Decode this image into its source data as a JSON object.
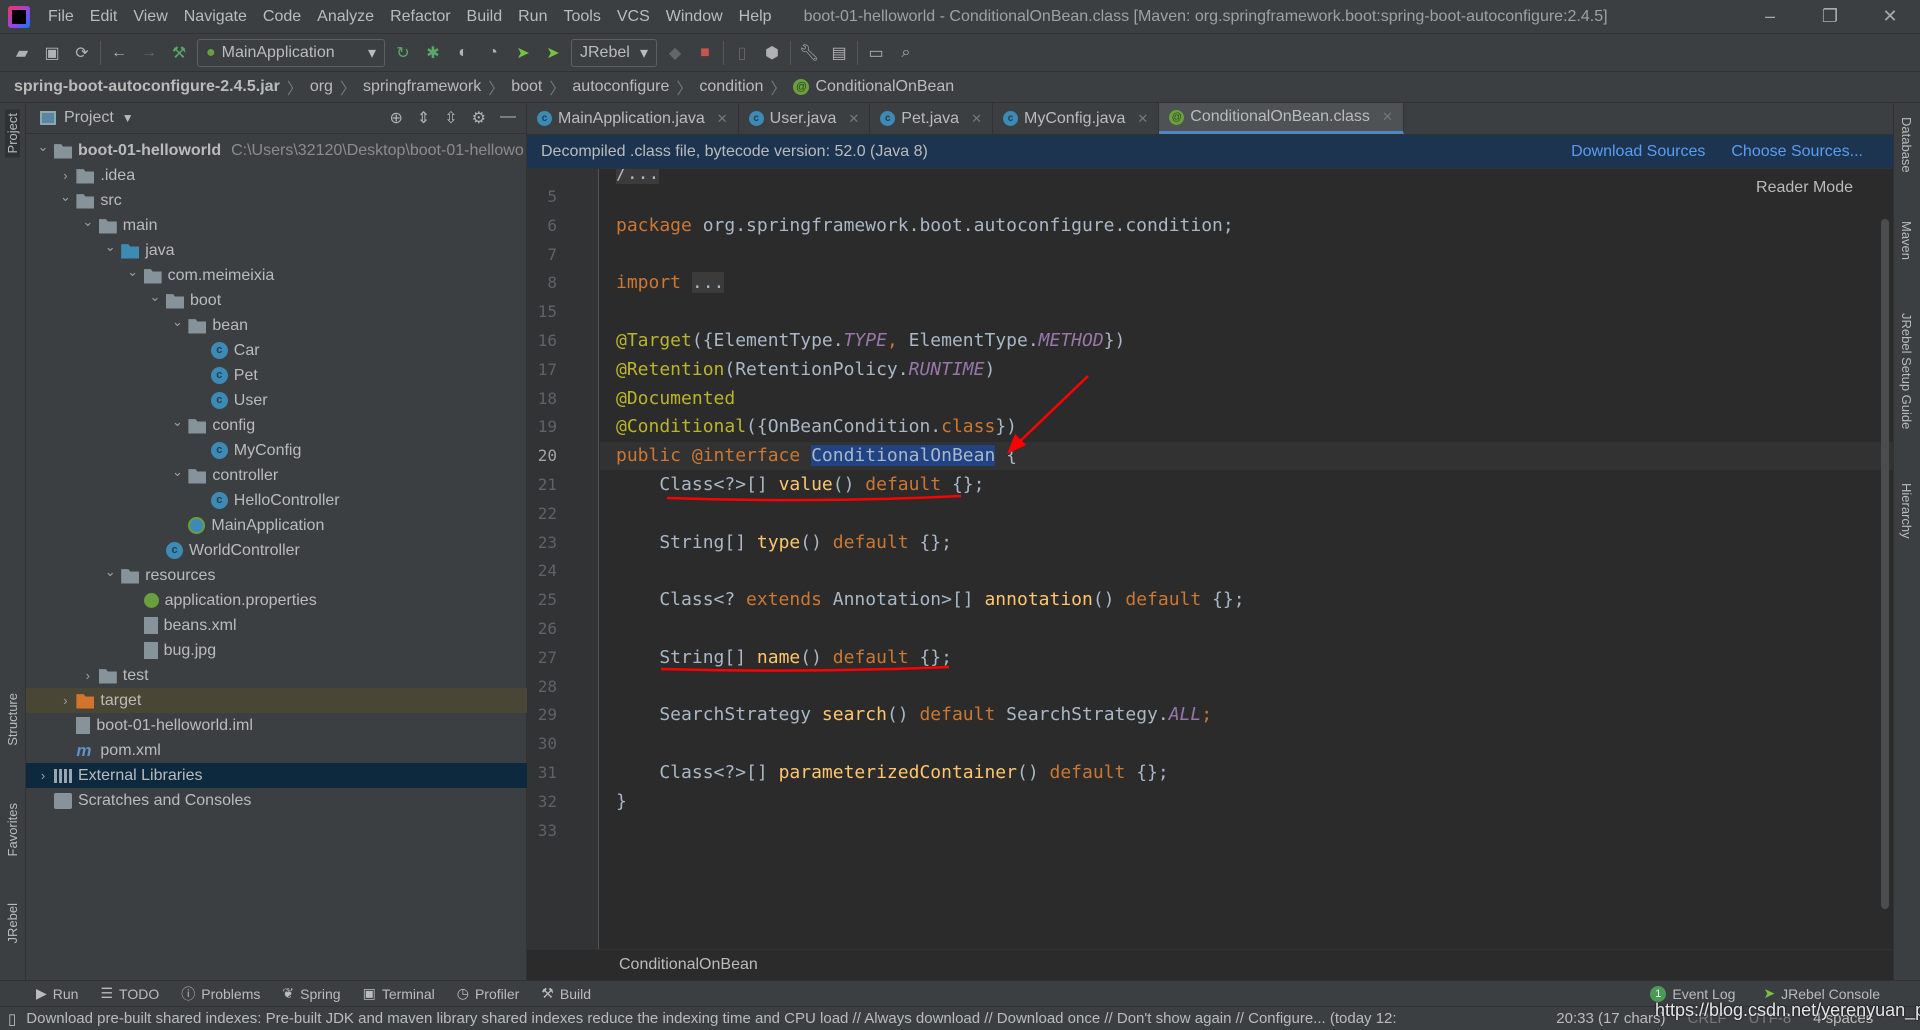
{
  "window": {
    "title": "boot-01-helloworld - ConditionalOnBean.class [Maven: org.springframework.boot:spring-boot-autoconfigure:2.4.5]"
  },
  "menu": [
    "File",
    "Edit",
    "View",
    "Navigate",
    "Code",
    "Analyze",
    "Refactor",
    "Build",
    "Run",
    "Tools",
    "VCS",
    "Window",
    "Help"
  ],
  "toolbar": {
    "run_config": "MainApplication",
    "jrebel": "JRebel"
  },
  "breadcrumb": [
    "spring-boot-autoconfigure-2.4.5.jar",
    "org",
    "springframework",
    "boot",
    "autoconfigure",
    "condition",
    "ConditionalOnBean"
  ],
  "left_stripe": {
    "project": "Project",
    "structure": "Structure",
    "favorites": "Favorites",
    "jrebel": "JRebel"
  },
  "right_stripe": {
    "database": "Database",
    "maven": "Maven",
    "jrebel_guide": "JRebel Setup Guide",
    "hierarchy": "Hierarchy"
  },
  "project": {
    "title": "Project",
    "tree": [
      {
        "d": 0,
        "a": "open",
        "i": "folder",
        "label": "boot-01-helloworld",
        "path": "C:\\Users\\32120\\Desktop\\boot-01-hellowo",
        "bold": true
      },
      {
        "d": 1,
        "a": "closed",
        "i": "folder",
        "label": ".idea"
      },
      {
        "d": 1,
        "a": "open",
        "i": "folder",
        "label": "src"
      },
      {
        "d": 2,
        "a": "open",
        "i": "folder",
        "label": "main"
      },
      {
        "d": 3,
        "a": "open",
        "i": "folder blue",
        "label": "java"
      },
      {
        "d": 4,
        "a": "open",
        "i": "pkg",
        "label": "com.meimeixia"
      },
      {
        "d": 5,
        "a": "open",
        "i": "pkg",
        "label": "boot"
      },
      {
        "d": 6,
        "a": "open",
        "i": "pkg",
        "label": "bean"
      },
      {
        "d": 7,
        "a": "",
        "i": "cls",
        "label": "Car"
      },
      {
        "d": 7,
        "a": "",
        "i": "cls",
        "label": "Pet"
      },
      {
        "d": 7,
        "a": "",
        "i": "cls",
        "label": "User"
      },
      {
        "d": 6,
        "a": "open",
        "i": "pkg",
        "label": "config"
      },
      {
        "d": 7,
        "a": "",
        "i": "cls",
        "label": "MyConfig"
      },
      {
        "d": 6,
        "a": "open",
        "i": "pkg",
        "label": "controller"
      },
      {
        "d": 7,
        "a": "",
        "i": "cls",
        "label": "HelloController"
      },
      {
        "d": 6,
        "a": "",
        "i": "spring",
        "label": "MainApplication"
      },
      {
        "d": 5,
        "a": "",
        "i": "cls",
        "label": "WorldController"
      },
      {
        "d": 3,
        "a": "open",
        "i": "folder",
        "label": "resources"
      },
      {
        "d": 4,
        "a": "",
        "i": "props",
        "label": "application.properties"
      },
      {
        "d": 4,
        "a": "",
        "i": "file",
        "label": "beans.xml"
      },
      {
        "d": 4,
        "a": "",
        "i": "file",
        "label": "bug.jpg"
      },
      {
        "d": 2,
        "a": "closed",
        "i": "folder",
        "label": "test"
      },
      {
        "d": 1,
        "a": "closed",
        "i": "folder orange",
        "label": "target",
        "state": "hl"
      },
      {
        "d": 1,
        "a": "",
        "i": "file",
        "label": "boot-01-helloworld.iml"
      },
      {
        "d": 1,
        "a": "",
        "i": "mvn",
        "label": "pom.xml"
      },
      {
        "d": 0,
        "a": "closed",
        "i": "lib",
        "label": "External Libraries",
        "state": "sel"
      },
      {
        "d": 0,
        "a": "",
        "i": "scr",
        "label": "Scratches and Consoles"
      }
    ]
  },
  "tabs": [
    {
      "label": "MainApplication.java",
      "icon": "spring-class-icon"
    },
    {
      "label": "User.java",
      "icon": "class-icon"
    },
    {
      "label": "Pet.java",
      "icon": "class-icon"
    },
    {
      "label": "MyConfig.java",
      "icon": "class-icon"
    },
    {
      "label": "ConditionalOnBean.class",
      "icon": "annotation-icon",
      "active": true
    }
  ],
  "banner": {
    "text": "Decompiled .class file, bytecode version: 52.0 (Java 8)",
    "download": "Download Sources",
    "choose": "Choose Sources..."
  },
  "editor": {
    "reader_mode": "Reader Mode",
    "current_line": "20",
    "lines": [
      {
        "n": "5",
        "t": []
      },
      {
        "n": "6",
        "t": [
          [
            "kw",
            "package "
          ],
          [
            "",
            "org.springframework.boot.autoconfigure.condition;"
          ]
        ]
      },
      {
        "n": "7",
        "t": []
      },
      {
        "n": "8",
        "t": [
          [
            "kw",
            "import "
          ],
          [
            "fold",
            "..."
          ]
        ]
      },
      {
        "n": "15",
        "t": []
      },
      {
        "n": "16",
        "t": [
          [
            "an",
            "@Target"
          ],
          [
            "",
            "({ElementType."
          ],
          [
            "st",
            "TYPE"
          ],
          [
            "kw",
            ", "
          ],
          [
            "",
            "ElementType."
          ],
          [
            "st",
            "METHOD"
          ],
          [
            "",
            "})"
          ]
        ]
      },
      {
        "n": "17",
        "t": [
          [
            "an",
            "@Retention"
          ],
          [
            "",
            "(RetentionPolicy."
          ],
          [
            "st",
            "RUNTIME"
          ],
          [
            "",
            ")"
          ]
        ]
      },
      {
        "n": "18",
        "t": [
          [
            "an",
            "@Documented"
          ]
        ]
      },
      {
        "n": "19",
        "t": [
          [
            "an",
            "@Conditional"
          ],
          [
            "",
            "({OnBeanCondition."
          ],
          [
            "kw",
            "class"
          ],
          [
            "",
            "})"
          ]
        ]
      },
      {
        "n": "20",
        "t": [
          [
            "kw",
            "public "
          ],
          [
            "kw",
            "@interface "
          ],
          [
            "sel",
            "ConditionalOnBean"
          ],
          [
            "",
            " {"
          ]
        ]
      },
      {
        "n": "21",
        "t": [
          [
            "",
            "    Class<?>[] "
          ],
          [
            "fn",
            "value"
          ],
          [
            "",
            "() "
          ],
          [
            "kw",
            "default "
          ],
          [
            "",
            "{};"
          ]
        ]
      },
      {
        "n": "22",
        "t": []
      },
      {
        "n": "23",
        "t": [
          [
            "",
            "    String[] "
          ],
          [
            "fn",
            "type"
          ],
          [
            "",
            "() "
          ],
          [
            "kw",
            "default "
          ],
          [
            "",
            "{};"
          ]
        ]
      },
      {
        "n": "24",
        "t": []
      },
      {
        "n": "25",
        "t": [
          [
            "",
            "    Class<? "
          ],
          [
            "kw",
            "extends "
          ],
          [
            "",
            "Annotation>[] "
          ],
          [
            "fn",
            "annotation"
          ],
          [
            "",
            "() "
          ],
          [
            "kw",
            "default "
          ],
          [
            "",
            "{};"
          ]
        ]
      },
      {
        "n": "26",
        "t": []
      },
      {
        "n": "27",
        "t": [
          [
            "",
            "    String[] "
          ],
          [
            "fn",
            "name"
          ],
          [
            "",
            "() "
          ],
          [
            "kw",
            "default "
          ],
          [
            "",
            "{};"
          ]
        ]
      },
      {
        "n": "28",
        "t": []
      },
      {
        "n": "29",
        "t": [
          [
            "",
            "    SearchStrategy "
          ],
          [
            "fn",
            "search"
          ],
          [
            "",
            "() "
          ],
          [
            "kw",
            "default "
          ],
          [
            "",
            "SearchStrategy."
          ],
          [
            "st",
            "ALL"
          ],
          [
            "kw",
            ";"
          ]
        ]
      },
      {
        "n": "30",
        "t": []
      },
      {
        "n": "31",
        "t": [
          [
            "",
            "    Class<?>[] "
          ],
          [
            "fn",
            "parameterizedContainer"
          ],
          [
            "",
            "() "
          ],
          [
            "kw",
            "default "
          ],
          [
            "",
            "{};"
          ]
        ]
      },
      {
        "n": "32",
        "t": [
          [
            "",
            "}"
          ]
        ]
      },
      {
        "n": "33",
        "t": []
      }
    ],
    "breadcrumb": "ConditionalOnBean"
  },
  "annotation_color": "#ff0000",
  "toolwindows": {
    "left": [
      "Run",
      "TODO",
      "Problems",
      "Spring",
      "Terminal",
      "Profiler",
      "Build"
    ],
    "event_log": "Event Log",
    "event_count": "1",
    "jrebel_console": "JRebel Console"
  },
  "status": {
    "message": "Download pre-built shared indexes: Pre-built JDK and maven library shared indexes reduce the indexing time and CPU load // Always download // Download once // Don't show again // Configure... (today 12:",
    "position": "20:33 (17 chars)",
    "line_sep": "CRLF",
    "encoding": "UTF-8",
    "indent": "4 spaces"
  },
  "watermark": "https://blog.csdn.net/yerenyuan_pku"
}
